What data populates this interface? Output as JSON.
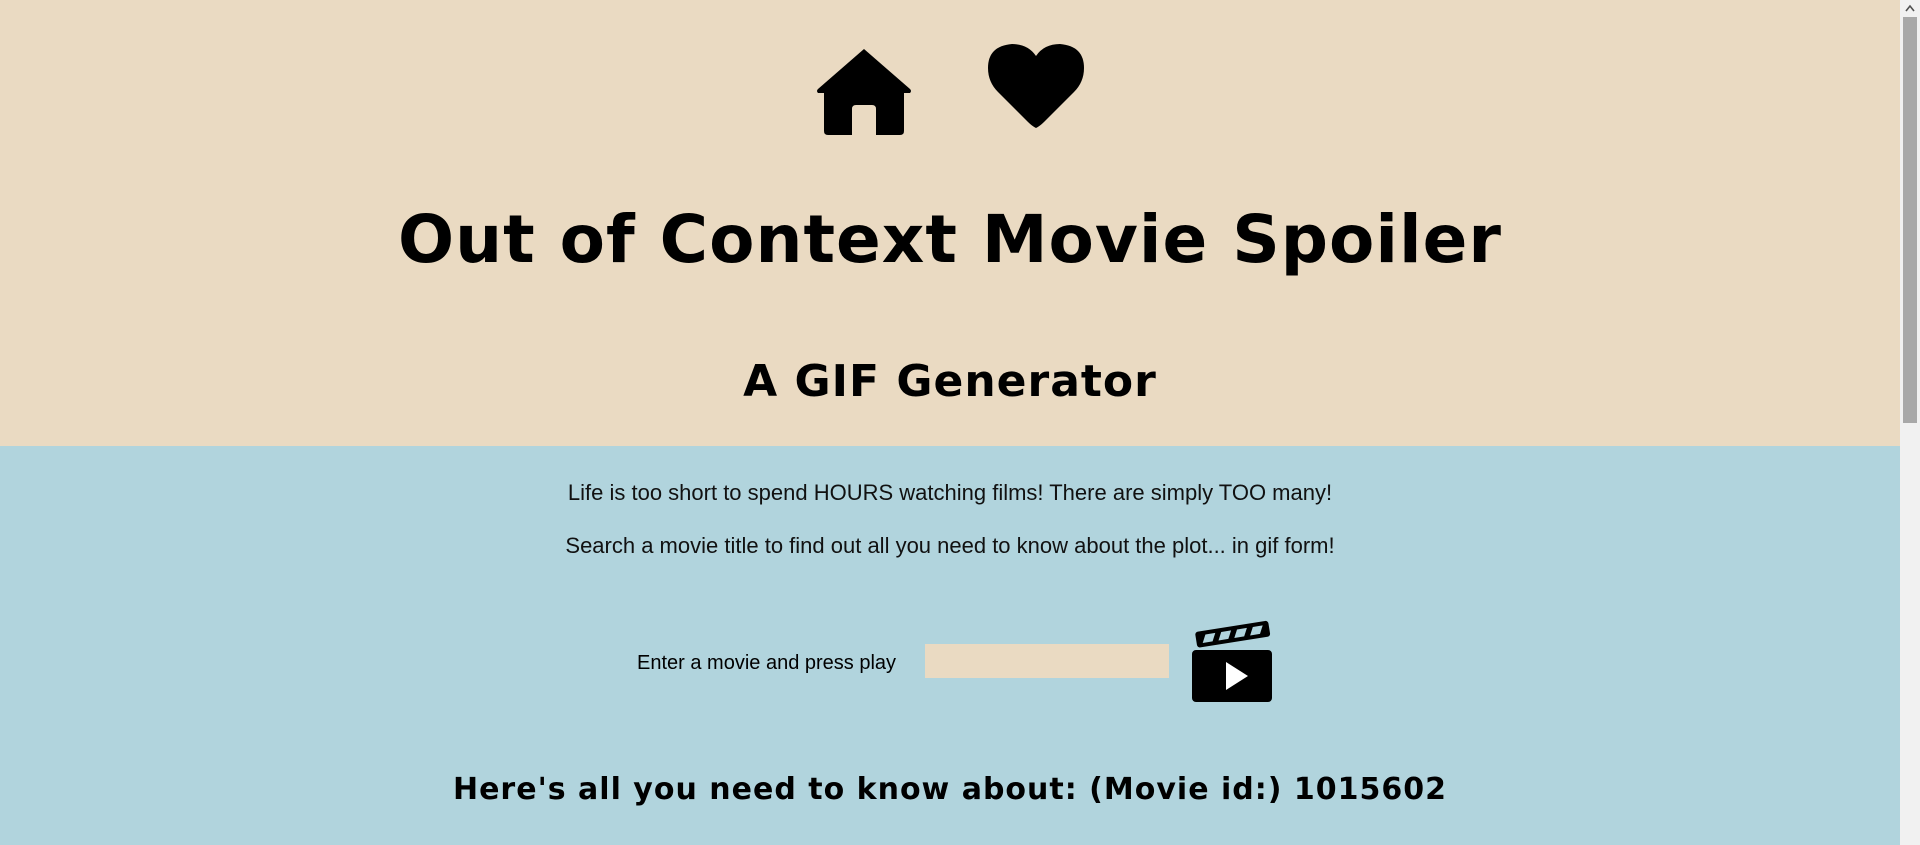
{
  "header": {
    "title": "Out of Context Movie Spoiler",
    "subtitle": "A GIF Generator",
    "nav": [
      {
        "icon": "home-icon"
      },
      {
        "icon": "heart-icon"
      }
    ]
  },
  "intro": {
    "line1": "Life is too short to spend HOURS watching films! There are simply TOO many!",
    "line2": "Search a movie title to find out all you need to know about the plot... in gif form!"
  },
  "search": {
    "label": "Enter a movie and press play",
    "value": "",
    "placeholder": "",
    "button_icon": "clapperboard-play-icon"
  },
  "results": {
    "heading": "Here's all you need to know about: (Movie id:) 1015602"
  },
  "colors": {
    "header_bg": "#eadac2",
    "body_bg": "#b1d4dd",
    "input_bg": "#eadac2",
    "text": "#000000"
  }
}
